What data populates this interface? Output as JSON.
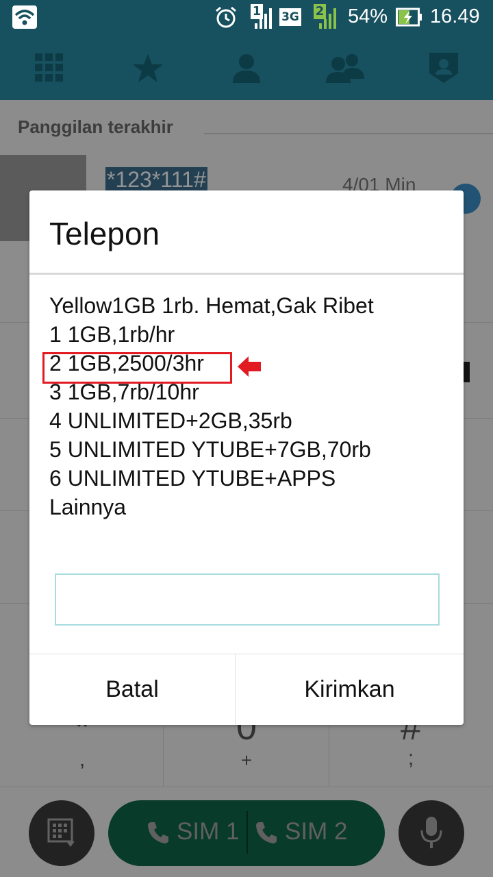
{
  "status_bar": {
    "sim1_label": "1",
    "network_type": "3G",
    "sim2_label": "2",
    "battery": "54%",
    "time": "16.49"
  },
  "tabs": [
    {
      "icon": "dialpad-grid-icon"
    },
    {
      "icon": "star-icon"
    },
    {
      "icon": "contact-icon"
    },
    {
      "icon": "group-icon"
    },
    {
      "icon": "profile-shield-icon"
    }
  ],
  "recent": {
    "section_title": "Panggilan terakhir",
    "number": "*123*111#",
    "duration": "4/01 Min"
  },
  "dialog": {
    "title": "Telepon",
    "message_lines": [
      "Yellow1GB 1rb. Hemat,Gak Ribet",
      "1 1GB,1rb/hr",
      "2 1GB,2500/3hr",
      "3 1GB,7rb/10hr",
      "4 UNLIMITED+2GB,35rb",
      "5 UNLIMITED YTUBE+7GB,70rb",
      "6 UNLIMITED YTUBE+APPS",
      "Lainnya"
    ],
    "highlighted_index": 2,
    "input_value": "",
    "cancel_label": "Batal",
    "send_label": "Kirimkan",
    "highlight_color": "#e21b23"
  },
  "keypad": {
    "star_main": "*",
    "star_sub": ",",
    "zero_main": "0",
    "zero_sub": "+",
    "hash_main": "#",
    "hash_sub": ";"
  },
  "call_bar": {
    "sim1_label": "SIM 1",
    "sim2_label": "SIM 2",
    "accent": "#0f6648"
  }
}
